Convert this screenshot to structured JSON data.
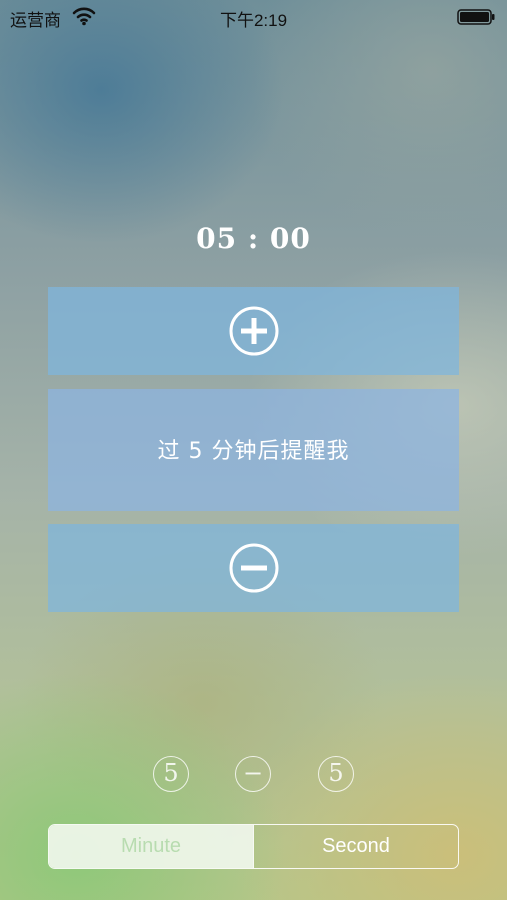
{
  "status_bar": {
    "carrier": "运营商",
    "time": "下午2:19"
  },
  "timer": {
    "display": "05 : 00"
  },
  "controls": {
    "increase_icon": "plus-circle-icon",
    "decrease_icon": "minus-circle-icon",
    "reminder_text": "过 5 分钟后提醒我"
  },
  "indicators": {
    "left": "5",
    "middle": "−",
    "right": "5"
  },
  "segmented": {
    "minute_label": "Minute",
    "second_label": "Second",
    "selected": "Minute"
  },
  "colors": {
    "panel": "#7eb6de",
    "segment_selected_bg": "#f0f6ec",
    "segment_selected_text": "#b8dcb0"
  }
}
